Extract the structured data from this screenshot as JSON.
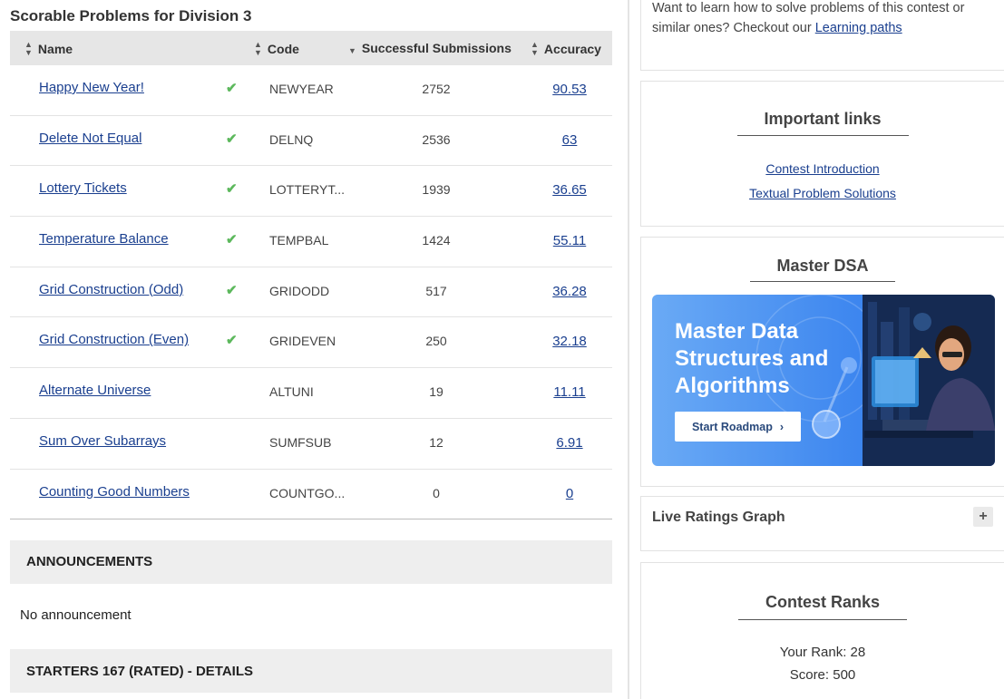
{
  "problems_section": {
    "title": "Scorable Problems for Division 3",
    "columns": {
      "name": "Name",
      "code": "Code",
      "subs": "Successful Submissions",
      "accuracy": "Accuracy"
    },
    "rows": [
      {
        "name": "Happy New Year!",
        "code": "NEWYEAR",
        "subs": "2752",
        "accuracy": "90.53",
        "solved": "✔"
      },
      {
        "name": "Delete Not Equal",
        "code": "DELNQ",
        "subs": "2536",
        "accuracy": "63",
        "solved": "✔"
      },
      {
        "name": "Lottery Tickets",
        "code": "LOTTERYT...",
        "subs": "1939",
        "accuracy": "36.65",
        "solved": "✔"
      },
      {
        "name": "Temperature Balance",
        "code": "TEMPBAL",
        "subs": "1424",
        "accuracy": "55.11",
        "solved": "✔"
      },
      {
        "name": "Grid Construction (Odd)",
        "code": "GRIDODD",
        "subs": "517",
        "accuracy": "36.28",
        "solved": "✔"
      },
      {
        "name": "Grid Construction (Even)",
        "code": "GRIDEVEN",
        "subs": "250",
        "accuracy": "32.18",
        "solved": "✔"
      },
      {
        "name": "Alternate Universe",
        "code": "ALTUNI",
        "subs": "19",
        "accuracy": "11.11",
        "solved": ""
      },
      {
        "name": "Sum Over Subarrays",
        "code": "SUMFSUB",
        "subs": "12",
        "accuracy": "6.91",
        "solved": ""
      },
      {
        "name": "Counting Good Numbers",
        "code": "COUNTGO...",
        "subs": "0",
        "accuracy": "0",
        "solved": ""
      }
    ]
  },
  "announcements": {
    "title": "ANNOUNCEMENTS",
    "empty_text": "No announcement"
  },
  "details": {
    "title": "STARTERS 167 (RATED) - DETAILS"
  },
  "learn_card": {
    "text": "Want to learn how to solve problems of this contest or similar ones? Checkout our ",
    "link": "Learning paths"
  },
  "important_links": {
    "title": "Important links",
    "links": [
      "Contest Introduction",
      "Textual Problem Solutions"
    ]
  },
  "master_dsa": {
    "title": "Master DSA",
    "banner_lines": [
      "Master Data",
      "Structures and",
      "Algorithms"
    ],
    "button": "Start Roadmap",
    "button_icon": "chevron-right-icon"
  },
  "live_ratings": {
    "title": "Live Ratings Graph",
    "expand_icon": "+"
  },
  "contest_ranks": {
    "title": "Contest Ranks",
    "rank": "Your Rank: 28",
    "score": "Score: 500"
  },
  "colors": {
    "link": "#1a3f8f",
    "check": "#5cb85c",
    "banner_blue": "#3d86ef"
  }
}
